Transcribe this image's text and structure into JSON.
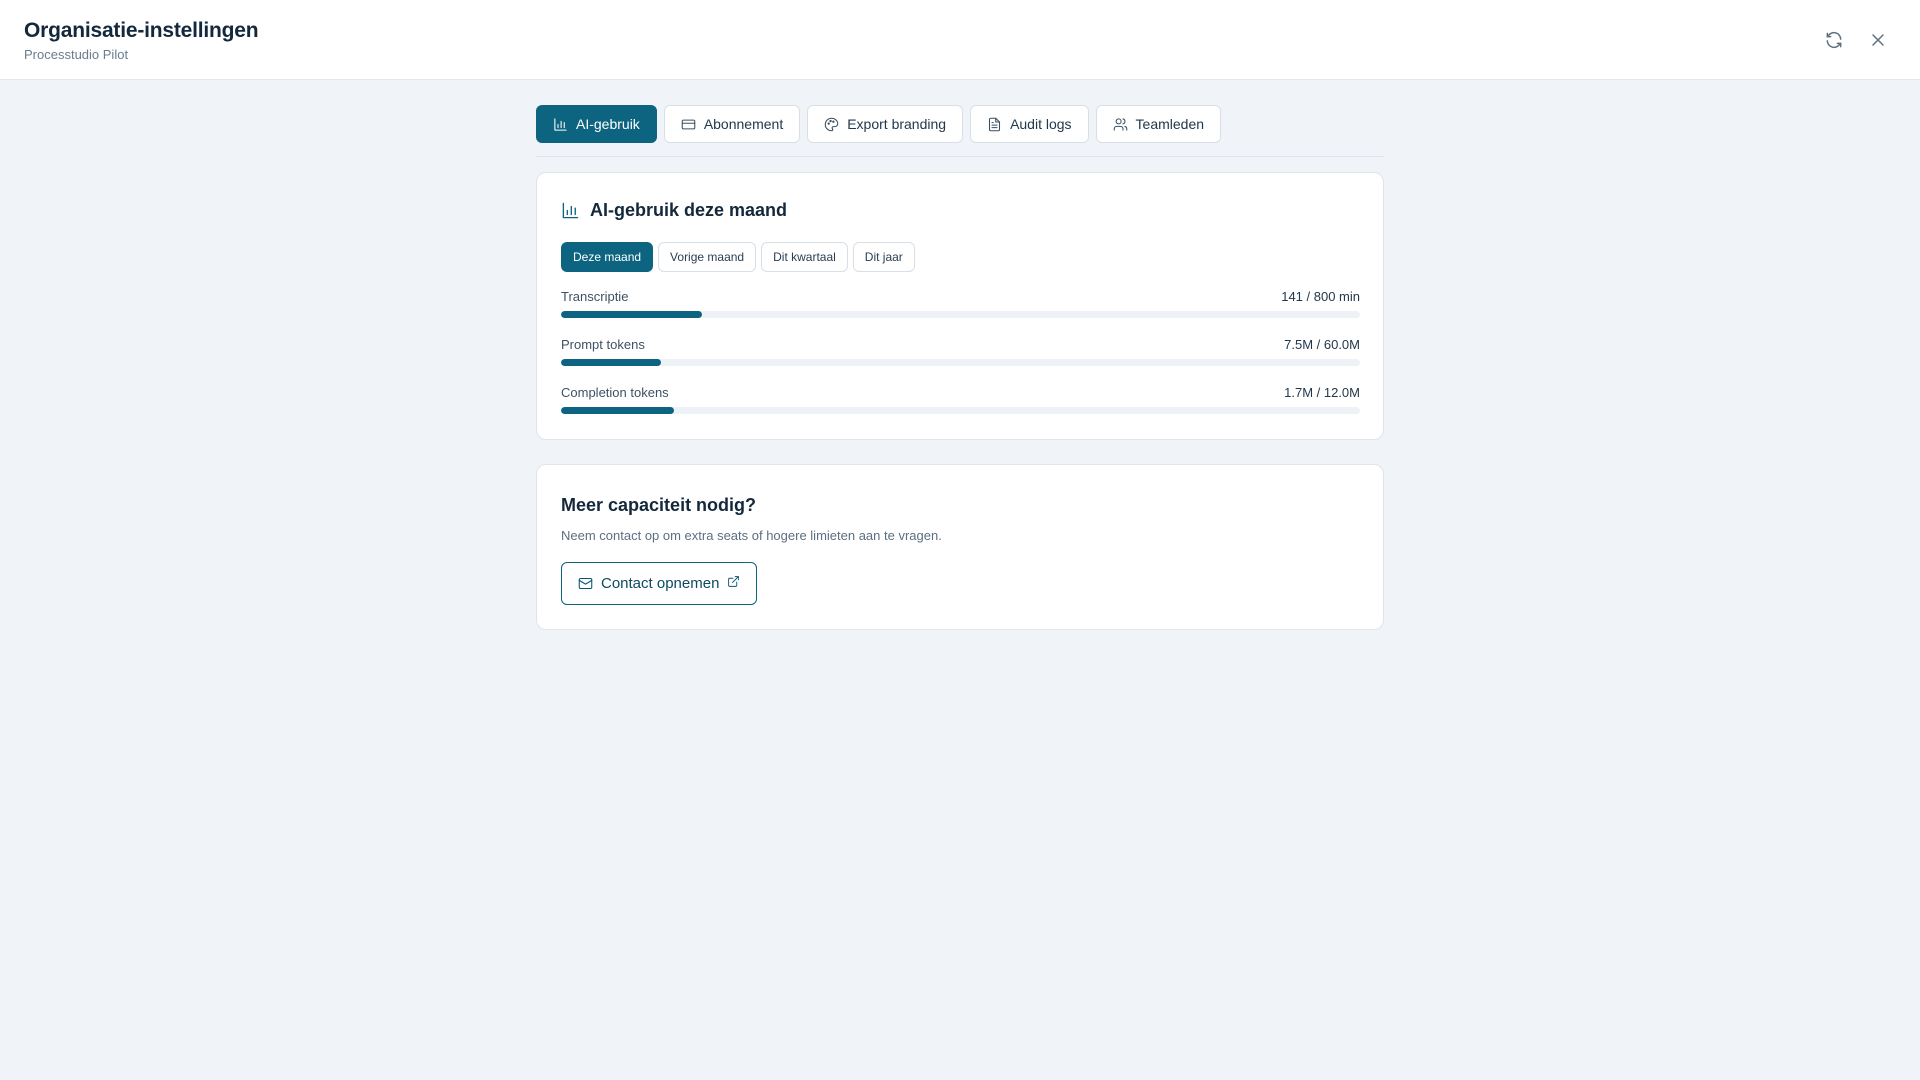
{
  "header": {
    "title": "Organisatie-instellingen",
    "subtitle": "Processtudio Pilot",
    "icons": [
      "refresh-icon",
      "close-icon"
    ]
  },
  "tabs": [
    {
      "label": "AI-gebruik",
      "icon": "bar-chart-icon",
      "active": true
    },
    {
      "label": "Abonnement",
      "icon": "credit-card-icon",
      "active": false
    },
    {
      "label": "Export branding",
      "icon": "palette-icon",
      "active": false
    },
    {
      "label": "Audit logs",
      "icon": "document-icon",
      "active": false
    },
    {
      "label": "Teamleden",
      "icon": "users-icon",
      "active": false
    }
  ],
  "usage": {
    "title": "AI-gebruik deze maand",
    "icon": "bar-chart-icon",
    "periods": [
      {
        "label": "Deze maand",
        "active": true
      },
      {
        "label": "Vorige maand",
        "active": false
      },
      {
        "label": "Dit kwartaal",
        "active": false
      },
      {
        "label": "Dit jaar",
        "active": false
      }
    ],
    "meters": [
      {
        "label": "Transcriptie",
        "value": "141 / 800 min",
        "fraction": 0.176
      },
      {
        "label": "Prompt tokens",
        "value": "7.5M / 60.0M",
        "fraction": 0.125
      },
      {
        "label": "Completion tokens",
        "value": "1.7M / 12.0M",
        "fraction": 0.142
      }
    ]
  },
  "contact": {
    "title": "Meer capaciteit nodig?",
    "description": "Neem contact op om extra seats of hogere limieten aan te vragen.",
    "button_label": "Contact opnemen",
    "button_icons": [
      "mail-icon",
      "external-link-icon"
    ]
  },
  "colors": {
    "accent": "#0c6480",
    "background": "#f0f4f8",
    "card": "#ffffff",
    "track": "#eef2f6"
  }
}
